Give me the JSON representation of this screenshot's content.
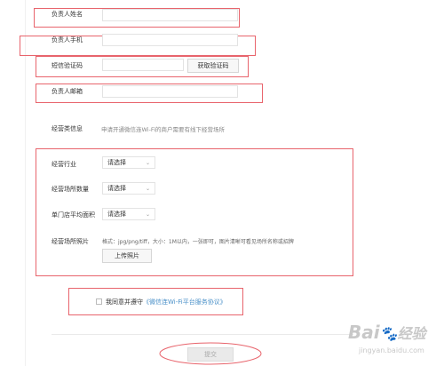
{
  "contact": {
    "name_label": "负责人姓名",
    "phone_label": "负责人手机",
    "sms_label": "短信验证码",
    "sms_button": "获取验证码",
    "email_label": "负责人邮箱"
  },
  "business": {
    "section_label": "经营类信息",
    "section_hint": "申请开通微信连Wi-Fi的商户需要有线下经营场所",
    "industry_label": "经营行业",
    "industry_value": "请选择",
    "venue_count_label": "经营场所数量",
    "venue_count_value": "请选择",
    "area_label": "单门店平均面积",
    "area_value": "请选择",
    "photo_label": "经营场所照片",
    "photo_hint": "格式：jpg/png/tiff，大小：1M以内，一张即可，图片清晰可看见场所名称或招牌",
    "upload_button": "上传照片"
  },
  "agreement": {
    "prefix": "我同意并遵守",
    "link_text": "《微信连Wi-Fi平台服务协议》"
  },
  "submit_label": "提交",
  "watermark": {
    "brand": "Bai",
    "brand2": "经验",
    "url": "jingyan.baidu.com"
  },
  "colors": {
    "annotation_red": "#e8646c",
    "link_blue": "#4a90c8"
  }
}
